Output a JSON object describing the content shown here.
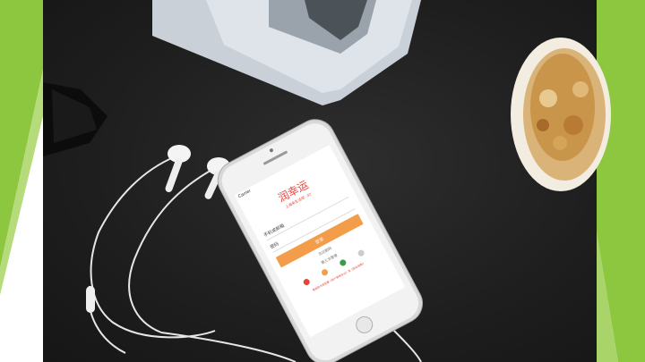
{
  "slide": {
    "accent_color": "#8dc63f",
    "desk_color": "#1e1e1e"
  },
  "phone_app": {
    "status_carrier": "Carrier",
    "brand_title": "润幸运",
    "brand_subtitle": "上海来生活吧 · 02",
    "phone_field_label": "手机或邮箱",
    "password_field_label": "密码",
    "login_button_label": "登录",
    "forgot_password_label": "忘记密码",
    "third_party_login_label": "第三方登录",
    "footer_text": "登录即代表同意《用户服务协议》及《隐私政策》",
    "accent_color": "#f39c4a",
    "brand_color": "#e8423a"
  }
}
